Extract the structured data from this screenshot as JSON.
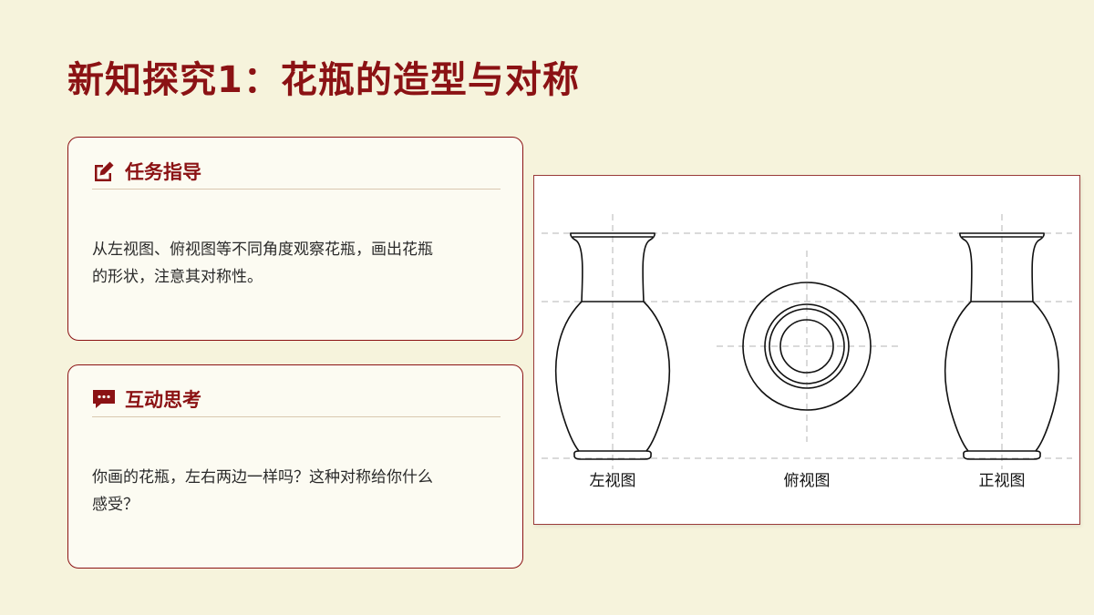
{
  "title": "新知探究1：花瓶的造型与对称",
  "cards": [
    {
      "icon": "edit-icon",
      "heading": "任务指导",
      "body_line1": "从左视图、俯视图等不同角度观察花瓶，画出花瓶",
      "body_line2": "的形状，注意其对称性。"
    },
    {
      "icon": "chat-icon",
      "heading": "互动思考",
      "body_line1": "你画的花瓶，左右两边一样吗？这种对称给你什么",
      "body_line2": "感受？"
    }
  ],
  "figure": {
    "labels": [
      "左视图",
      "俯视图",
      "正视图"
    ]
  },
  "colors": {
    "accent": "#8b1214",
    "background": "#f6f3dc",
    "card_background": "#fcfbf2"
  }
}
